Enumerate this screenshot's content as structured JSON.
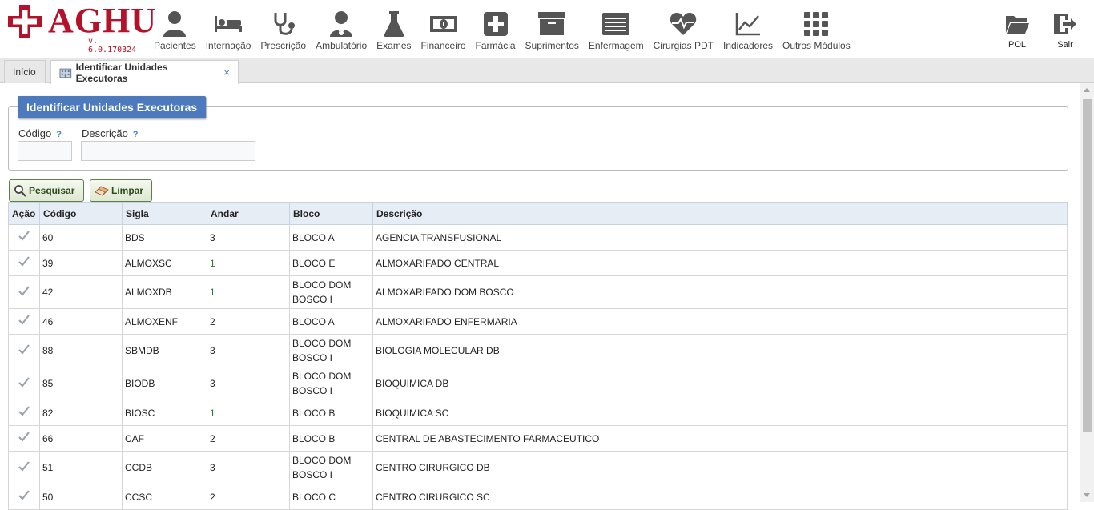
{
  "app": {
    "logo_text": "AGHU",
    "version": "v. 6.0.170324",
    "brand_color": "#b3122a"
  },
  "modules": [
    {
      "label": "Pacientes",
      "icon": "person-icon"
    },
    {
      "label": "Internação",
      "icon": "bed-icon"
    },
    {
      "label": "Prescrição",
      "icon": "stethoscope-icon"
    },
    {
      "label": "Ambulatório",
      "icon": "doctor-icon"
    },
    {
      "label": "Exames",
      "icon": "flask-icon"
    },
    {
      "label": "Financeiro",
      "icon": "money-icon"
    },
    {
      "label": "Farmácia",
      "icon": "plus-box-icon"
    },
    {
      "label": "Suprimentos",
      "icon": "archive-box-icon"
    },
    {
      "label": "Enfermagem",
      "icon": "list-card-icon"
    },
    {
      "label": "Cirurgias PDT",
      "icon": "heartbeat-icon"
    },
    {
      "label": "Indicadores",
      "icon": "line-chart-icon"
    },
    {
      "label": "Outros Módulos",
      "icon": "grid-icon"
    }
  ],
  "right_modules": [
    {
      "label": "POL",
      "icon": "folder-icon"
    },
    {
      "label": "Sair",
      "icon": "exit-icon"
    }
  ],
  "tabs": [
    {
      "label": "Início",
      "active": false
    },
    {
      "label": "Identificar Unidades Executoras",
      "active": true,
      "close": "×"
    }
  ],
  "form": {
    "legend": "Identificar Unidades Executoras",
    "codigo_label": "Código",
    "descricao_label": "Descrição",
    "help_mark": "?",
    "codigo_value": "",
    "descricao_value": "",
    "search_button": "Pesquisar",
    "clear_button": "Limpar"
  },
  "table": {
    "headers": [
      "Ação",
      "Código",
      "Sigla",
      "Andar",
      "Bloco",
      "Descrição"
    ],
    "rows": [
      {
        "codigo": "60",
        "sigla": "BDS",
        "andar": "3",
        "bloco": "BLOCO A",
        "descricao": "AGENCIA TRANSFUSIONAL"
      },
      {
        "codigo": "39",
        "sigla": "ALMOXSC",
        "andar": "1",
        "bloco": "BLOCO E",
        "descricao": "ALMOXARIFADO CENTRAL"
      },
      {
        "codigo": "42",
        "sigla": "ALMOXDB",
        "andar": "1",
        "bloco": "BLOCO DOM BOSCO I",
        "descricao": "ALMOXARIFADO DOM BOSCO"
      },
      {
        "codigo": "46",
        "sigla": "ALMOXENF",
        "andar": "2",
        "bloco": "BLOCO A",
        "descricao": "ALMOXARIFADO ENFERMARIA"
      },
      {
        "codigo": "88",
        "sigla": "SBMDB",
        "andar": "3",
        "bloco": "BLOCO DOM BOSCO I",
        "descricao": "BIOLOGIA MOLECULAR DB"
      },
      {
        "codigo": "85",
        "sigla": "BIODB",
        "andar": "3",
        "bloco": "BLOCO DOM BOSCO I",
        "descricao": "BIOQUIMICA DB"
      },
      {
        "codigo": "82",
        "sigla": "BIOSC",
        "andar": "1",
        "bloco": "BLOCO B",
        "descricao": "BIOQUIMICA SC"
      },
      {
        "codigo": "66",
        "sigla": "CAF",
        "andar": "2",
        "bloco": "BLOCO B",
        "descricao": "CENTRAL DE ABASTECIMENTO FARMACEUTICO"
      },
      {
        "codigo": "51",
        "sigla": "CCDB",
        "andar": "3",
        "bloco": "BLOCO DOM BOSCO I",
        "descricao": "CENTRO CIRURGICO DB"
      },
      {
        "codigo": "50",
        "sigla": "CCSC",
        "andar": "2",
        "bloco": "BLOCO C",
        "descricao": "CENTRO CIRURGICO SC"
      }
    ]
  }
}
